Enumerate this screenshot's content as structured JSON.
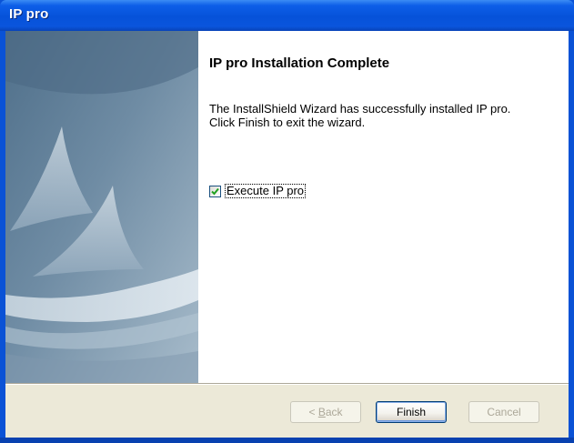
{
  "window": {
    "title": "IP pro"
  },
  "main": {
    "heading": "IP pro Installation Complete",
    "message_line1": "The InstallShield Wizard has successfully installed IP pro.",
    "message_line2": "Click Finish to exit the wizard.",
    "checkbox": {
      "label": "Execute IP pro",
      "checked": true
    }
  },
  "buttons": {
    "back_prefix": "< ",
    "back_accel": "B",
    "back_rest": "ack",
    "finish": "Finish",
    "cancel": "Cancel"
  },
  "colors": {
    "titlebar": "#0652d9",
    "dialog_bg": "#ece9d8",
    "content_bg": "#ffffff",
    "side_image_bg": "#5f7e98"
  },
  "icons": {
    "checkbox_mark": "check-icon",
    "side_art": "installshield-sail-art"
  }
}
